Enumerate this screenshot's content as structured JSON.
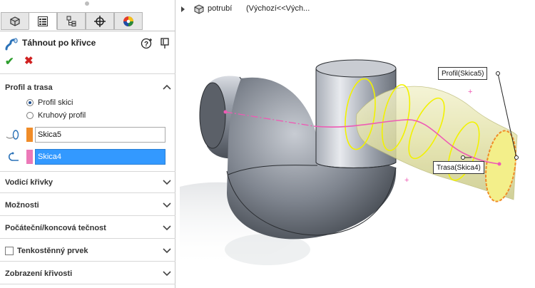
{
  "property_manager": {
    "tabs": [
      {
        "name": "feature-manager",
        "icon": "feature-tree-icon"
      },
      {
        "name": "property-manager",
        "icon": "property-list-icon"
      },
      {
        "name": "configuration-manager",
        "icon": "configuration-icon"
      },
      {
        "name": "dimxpert-manager",
        "icon": "crosshair-icon"
      },
      {
        "name": "display-manager",
        "icon": "appearance-ball-icon"
      }
    ],
    "active_tab": 1,
    "feature_title": "Táhnout po křivce",
    "feature_icon": "sweep-icon",
    "ok_label": "✔",
    "cancel_label": "✖",
    "sections": {
      "profile_path": {
        "label": "Profil a trasa",
        "radio_sketch": "Profil skici",
        "radio_circle": "Kruhový profil",
        "selected_option": "Profil skici",
        "profile_value": "Skica5",
        "path_value": "Skica4",
        "profile_color": "#f08c28",
        "path_color": "#ec79b8"
      },
      "guide_curves": {
        "label": "Vodicí křivky"
      },
      "options": {
        "label": "Možnosti"
      },
      "tangency": {
        "label": "Počáteční/koncová tečnost"
      },
      "thin_feature": {
        "label": "Tenkostěnný prvek",
        "checked": false
      },
      "curvature_display": {
        "label": "Zobrazení křivosti"
      }
    }
  },
  "graphics": {
    "tree_name": "potrubí",
    "tree_config": "(Výchozí<<Vých...",
    "callout_profile": "Profil(Skica5)",
    "callout_path": "Trasa(Skica4)"
  },
  "colors": {
    "accent_selection": "#3399ff",
    "ok_green": "#2e9e2e",
    "cancel_red": "#d02020",
    "preview_yellow": "#e8e890",
    "sketch_yellow": "#ffff00",
    "path_pink": "#ee5ab4",
    "pipe_gray": "#8a8f98"
  }
}
